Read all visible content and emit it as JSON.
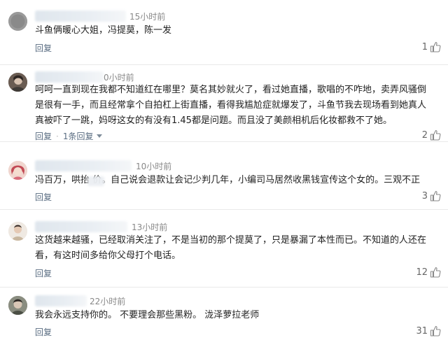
{
  "comments": [
    {
      "time": "15小时前",
      "text": "斗鱼俩暖心大姐，冯提莫，陈一发",
      "reply": "回复",
      "likes": "1"
    },
    {
      "time": "0小时前",
      "text": "呵呵一直到现在我都不知道红在哪里？莫名其妙就火了，看过她直播，歌唱的不咋地，卖弄风骚倒是很有一手，而且经常拿个自拍杠上街直播，看得我尴尬症就爆发了，斗鱼节我去现场看到她真人真被吓了一跳，妈呀这女的有没有1.45都是问题。而且没了美颜相机后化妆都救不了她。",
      "reply": "回复",
      "replies_link": "1条回复",
      "likes": "2"
    },
    {
      "time": "10小时前",
      "text": "冯百万，哄抬  价。自己说会退款让会记少判几年，小编司马居然收黑钱宣传这个女的。三观不正",
      "reply": "回复",
      "likes": "3"
    },
    {
      "time": "13小时前",
      "text": "这货越来越骚，已经取消关注了，不是当初的那个提莫了，只是暴漏了本性而已。不知道的人还在看，有这时间多给你父母打个电话。",
      "reply": "回复",
      "likes": "12"
    },
    {
      "time": "22小时前",
      "text": "我会永远支持你的。 不要理会那些黑粉。 泷泽萝拉老师",
      "reply": "回复",
      "likes": "31"
    }
  ],
  "icons": {
    "like": "thumbs-up-icon",
    "expand": "chevron-down-icon"
  },
  "colors": {
    "link": "#5a6d82",
    "time": "#888888",
    "divider": "#e9e9e9"
  }
}
